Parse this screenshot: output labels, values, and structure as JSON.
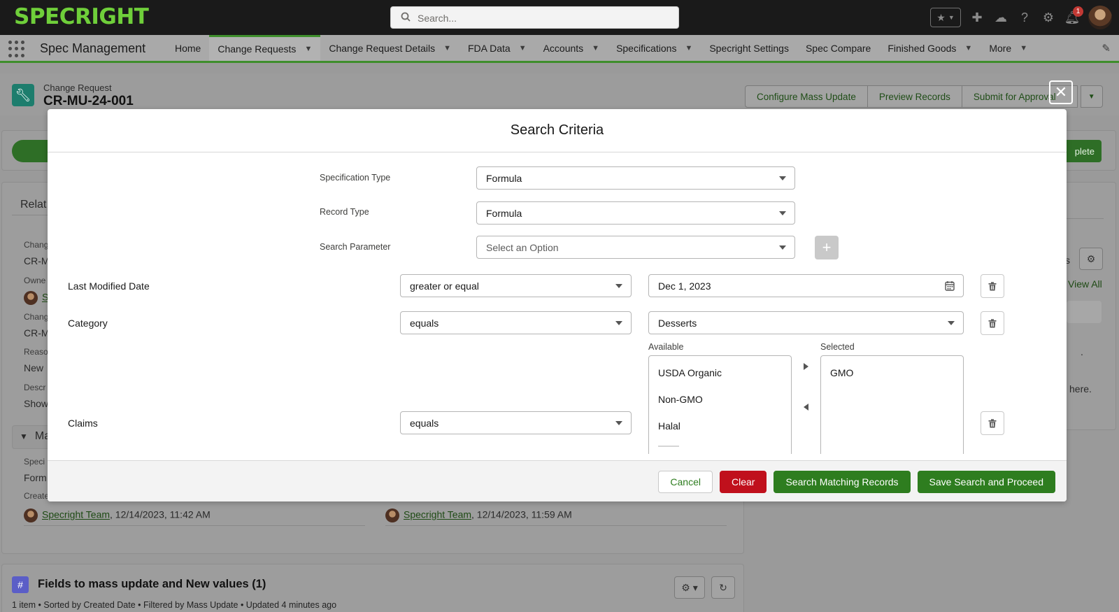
{
  "topbar": {
    "logo": "SPECRIGHT",
    "search_placeholder": "Search...",
    "notification_count": "1"
  },
  "nav": {
    "app_name": "Spec Management",
    "items": [
      {
        "label": "Home",
        "has_menu": false,
        "active": false
      },
      {
        "label": "Change Requests",
        "has_menu": true,
        "active": true
      },
      {
        "label": "Change Request Details",
        "has_menu": true,
        "active": false
      },
      {
        "label": "FDA Data",
        "has_menu": true,
        "active": false
      },
      {
        "label": "Accounts",
        "has_menu": true,
        "active": false
      },
      {
        "label": "Specifications",
        "has_menu": true,
        "active": false
      },
      {
        "label": "Specright Settings",
        "has_menu": false,
        "active": false
      },
      {
        "label": "Spec Compare",
        "has_menu": false,
        "active": false
      },
      {
        "label": "Finished Goods",
        "has_menu": true,
        "active": false
      },
      {
        "label": "More",
        "has_menu": true,
        "active": false
      }
    ]
  },
  "record": {
    "object_label": "Change Request",
    "name": "CR-MU-24-001",
    "actions": [
      "Configure Mass Update",
      "Preview Records",
      "Submit for Approval"
    ],
    "path_complete_label": "plete"
  },
  "background": {
    "related_label": "Relat",
    "fields": [
      {
        "label": "Chang",
        "value": "CR-M"
      },
      {
        "label": "Owne",
        "value": "S"
      },
      {
        "label": "Chang",
        "value": "CR-M"
      },
      {
        "label": "Reaso",
        "value": "New"
      },
      {
        "label": "Descr",
        "value": "Show"
      }
    ],
    "section_label": "Ma",
    "spec_label": "Speci",
    "spec_value": "Form",
    "created_label": "Create",
    "created_by_1": "Specright Team",
    "created_date_1": ", 12/14/2023, 11:42 AM",
    "created_by_2": "Specright Team",
    "created_date_2": ", 12/14/2023, 11:59 AM",
    "right_s": "s",
    "view_all": "View All",
    "right_dot": ".",
    "right_here": "here.",
    "mass_update_title": "Fields to mass update and New values (1)",
    "mass_update_meta": "1 item • Sorted by Created Date • Filtered by Mass Update • Updated 4 minutes ago"
  },
  "modal": {
    "title": "Search Criteria",
    "spec_type_label": "Specification Type",
    "spec_type_value": "Formula",
    "record_type_label": "Record Type",
    "record_type_value": "Formula",
    "search_param_label": "Search Parameter",
    "search_param_placeholder": "Select an Option",
    "criteria": {
      "last_modified": {
        "label": "Last Modified Date",
        "operator": "greater or equal",
        "value": "Dec 1, 2023"
      },
      "category": {
        "label": "Category",
        "operator": "equals",
        "value": "Desserts"
      },
      "claims": {
        "label": "Claims",
        "operator": "equals",
        "available_label": "Available",
        "selected_label": "Selected",
        "available": [
          "USDA Organic",
          "Non-GMO",
          "Halal"
        ],
        "selected": [
          "GMO"
        ]
      }
    },
    "buttons": {
      "cancel": "Cancel",
      "clear": "Clear",
      "search": "Search Matching Records",
      "save": "Save Search and Proceed"
    }
  }
}
